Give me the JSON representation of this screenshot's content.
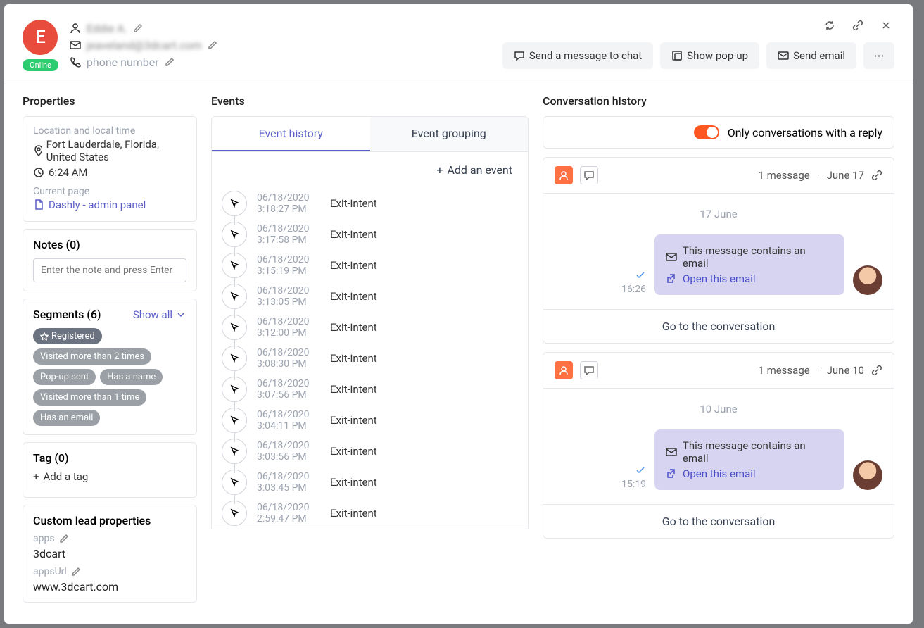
{
  "header": {
    "initial": "E",
    "status": "Online",
    "name": "Eddie A.",
    "email": "jeaveland@3dcart.com",
    "phone": "phone number",
    "actions": {
      "chat": "Send a message to chat",
      "popup": "Show pop-up",
      "email": "Send email"
    }
  },
  "properties": {
    "title": "Properties",
    "loc_label": "Location and local time",
    "location": "Fort Lauderdale, Florida, United States",
    "time": "6:24 AM",
    "page_label": "Current page",
    "page_name": "Dashly - admin panel",
    "notes_title": "Notes (0)",
    "notes_placeholder": "Enter the note and press Enter",
    "segments_title": "Segments (6)",
    "show_all": "Show all",
    "segments": [
      "Registered",
      "Visited more than 2 times",
      "Pop-up sent",
      "Has a name",
      "Visited more than 1 time",
      "Has an email"
    ],
    "tag_title": "Tag (0)",
    "add_tag": "Add a tag",
    "custom_title": "Custom lead properties",
    "custom": [
      {
        "label": "apps",
        "value": "3dcart"
      },
      {
        "label": "appsUrl",
        "value": "www.3dcart.com"
      }
    ]
  },
  "events": {
    "title": "Events",
    "tab1": "Event history",
    "tab2": "Event grouping",
    "add": "Add an event",
    "list": [
      {
        "d": "06/18/2020",
        "t": "3:18:27 PM",
        "n": "Exit-intent"
      },
      {
        "d": "06/18/2020",
        "t": "3:17:58 PM",
        "n": "Exit-intent"
      },
      {
        "d": "06/18/2020",
        "t": "3:15:19 PM",
        "n": "Exit-intent"
      },
      {
        "d": "06/18/2020",
        "t": "3:13:05 PM",
        "n": "Exit-intent"
      },
      {
        "d": "06/18/2020",
        "t": "3:12:00 PM",
        "n": "Exit-intent"
      },
      {
        "d": "06/18/2020",
        "t": "3:08:30 PM",
        "n": "Exit-intent"
      },
      {
        "d": "06/18/2020",
        "t": "3:07:56 PM",
        "n": "Exit-intent"
      },
      {
        "d": "06/18/2020",
        "t": "3:04:11 PM",
        "n": "Exit-intent"
      },
      {
        "d": "06/18/2020",
        "t": "3:03:56 PM",
        "n": "Exit-intent"
      },
      {
        "d": "06/18/2020",
        "t": "3:03:45 PM",
        "n": "Exit-intent"
      },
      {
        "d": "06/18/2020",
        "t": "2:59:47 PM",
        "n": "Exit-intent"
      }
    ]
  },
  "conversation": {
    "title": "Conversation history",
    "filter": "Only conversations with a reply",
    "items": [
      {
        "meta": "1 message",
        "date": "June 17",
        "body_date": "17 June",
        "time": "16:26",
        "line1": "This message contains an email",
        "line2": "Open this email",
        "goto": "Go to the conversation"
      },
      {
        "meta": "1 message",
        "date": "June 10",
        "body_date": "10 June",
        "time": "15:19",
        "line1": "This message contains an email",
        "line2": "Open this email",
        "goto": "Go to the conversation"
      }
    ]
  }
}
